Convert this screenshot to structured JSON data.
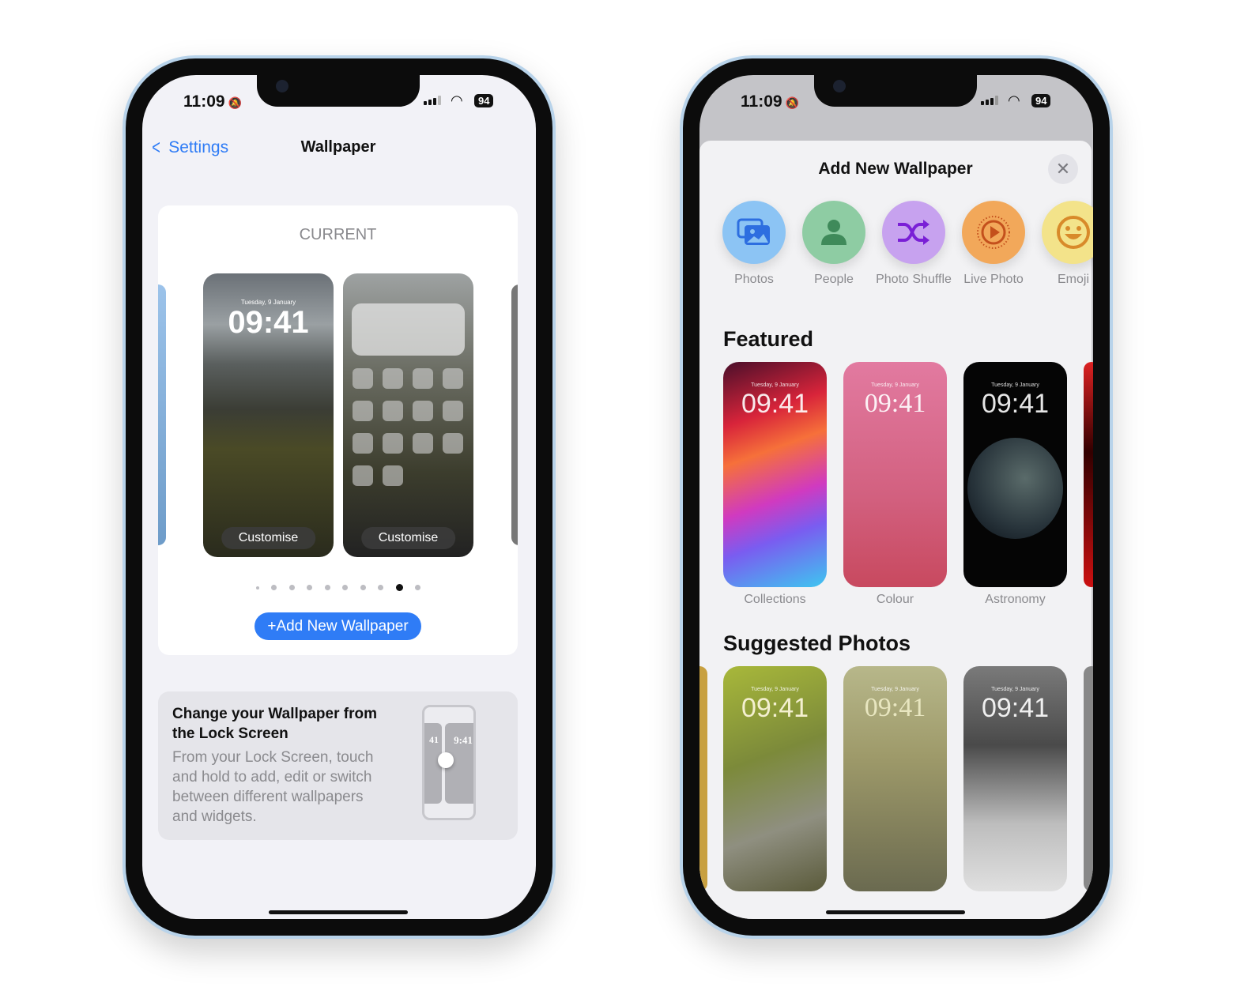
{
  "status": {
    "time": "11:09",
    "battery": "94",
    "silent_icon": "bell-slash-icon"
  },
  "left": {
    "nav": {
      "back_label": "Settings",
      "title": "Wallpaper"
    },
    "current_label": "CURRENT",
    "lock_preview": {
      "date": "Tuesday, 9 January",
      "time": "09:41",
      "customise": "Customise"
    },
    "home_preview": {
      "customise": "Customise"
    },
    "page_dots": {
      "count": 10,
      "active_index": 8
    },
    "add_button": "+Add New Wallpaper",
    "info": {
      "title": "Change your Wallpaper from the Lock Screen",
      "body": "From your Lock Screen, touch and hold to add, edit or switch between different wallpapers and widgets.",
      "illus_time_left": "41",
      "illus_time_right": "9:41"
    }
  },
  "right": {
    "sheet_title": "Add New Wallpaper",
    "close_icon": "xmark-icon",
    "categories": [
      {
        "label": "Photos",
        "icon": "photos-icon",
        "color": "#8cc4f4"
      },
      {
        "label": "People",
        "icon": "person-icon",
        "color": "#8ecca3"
      },
      {
        "label": "Photo Shuffle",
        "icon": "shuffle-icon",
        "color": "#c7a2ef"
      },
      {
        "label": "Live Photo",
        "icon": "live-photo-icon",
        "color": "#f2a85a"
      },
      {
        "label": "Emoji",
        "icon": "emoji-icon",
        "color": "#f3e38a"
      }
    ],
    "featured_heading": "Featured",
    "featured": [
      {
        "label": "Collections",
        "date": "Tuesday, 9 January",
        "time": "09:41"
      },
      {
        "label": "Colour",
        "date": "Tuesday, 9 January",
        "time": "09:41"
      },
      {
        "label": "Astronomy",
        "date": "Tuesday, 9 January",
        "time": "09:41"
      }
    ],
    "suggested_heading": "Suggested Photos",
    "suggested": [
      {
        "date": "Tuesday, 9 January",
        "time": "09:41"
      },
      {
        "date": "Tuesday, 9 January",
        "time": "09:41"
      },
      {
        "date": "Tuesday, 9 January",
        "time": "09:41"
      }
    ]
  }
}
